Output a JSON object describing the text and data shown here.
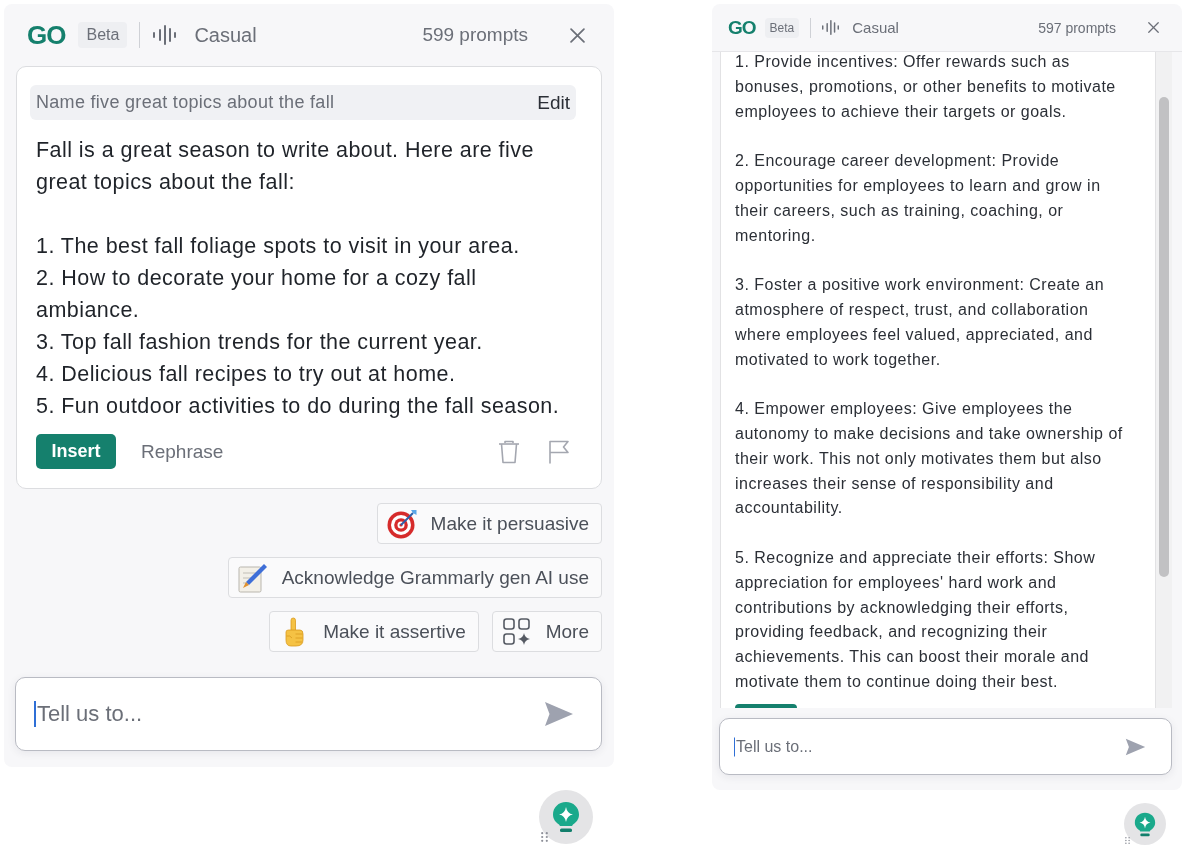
{
  "panels": [
    {
      "kind": "card",
      "header": {
        "logo": "GO",
        "badge": "Beta",
        "tone": "Casual",
        "prompts": "599 prompts"
      },
      "prompt": {
        "text": "Name five great topics about the fall",
        "edit": "Edit"
      },
      "response": {
        "intro": "Fall is a great season to write about. Here are five great topics about the fall:",
        "items": [
          "1. The best fall foliage spots to visit in your area.",
          "2. How to decorate your home for a cozy fall ambiance.",
          "3. Top fall fashion trends for the current year.",
          "4. Delicious fall recipes to try out at home.",
          "5. Fun outdoor activities to do during the fall season."
        ]
      },
      "actions": {
        "insert": "Insert",
        "rephrase": "Rephrase"
      },
      "suggestions": [
        {
          "kind": "suggestion",
          "label": "Make it persuasive"
        },
        {
          "kind": "suggestion",
          "label": "Acknowledge Grammarly gen AI use"
        },
        {
          "kind": "suggestion",
          "label": "Make it assertive"
        },
        {
          "kind": "more",
          "label": "More"
        }
      ],
      "input": {
        "placeholder": "Tell us to...",
        "focused": true
      }
    },
    {
      "kind": "scrolled",
      "header": {
        "logo": "GO",
        "badge": "Beta",
        "tone": "Casual",
        "prompts": "597 prompts"
      },
      "response": {
        "paragraphs": [
          "1. Provide incentives: Offer rewards such as bonuses, promotions, or other benefits to motivate employees to achieve their targets or goals.",
          "2. Encourage career development: Provide opportunities for employees to learn and grow in their careers, such as training, coaching, or mentoring.",
          "3. Foster a positive work environment: Create an atmosphere of respect, trust, and collaboration where employees feel valued, appreciated, and motivated to work together.",
          "4. Empower employees: Give employees the autonomy to make decisions and take ownership of their work. This not only motivates them but also increases their sense of responsibility and accountability.",
          "5. Recognize and appreciate their efforts: Show appreciation for employees' hard work and contributions by acknowledging their efforts, providing feedback, and recognizing their achievements. This can boost their morale and motivate them to continue doing their best."
        ]
      },
      "input": {
        "placeholder": "Tell us to...",
        "focused": true
      }
    }
  ]
}
